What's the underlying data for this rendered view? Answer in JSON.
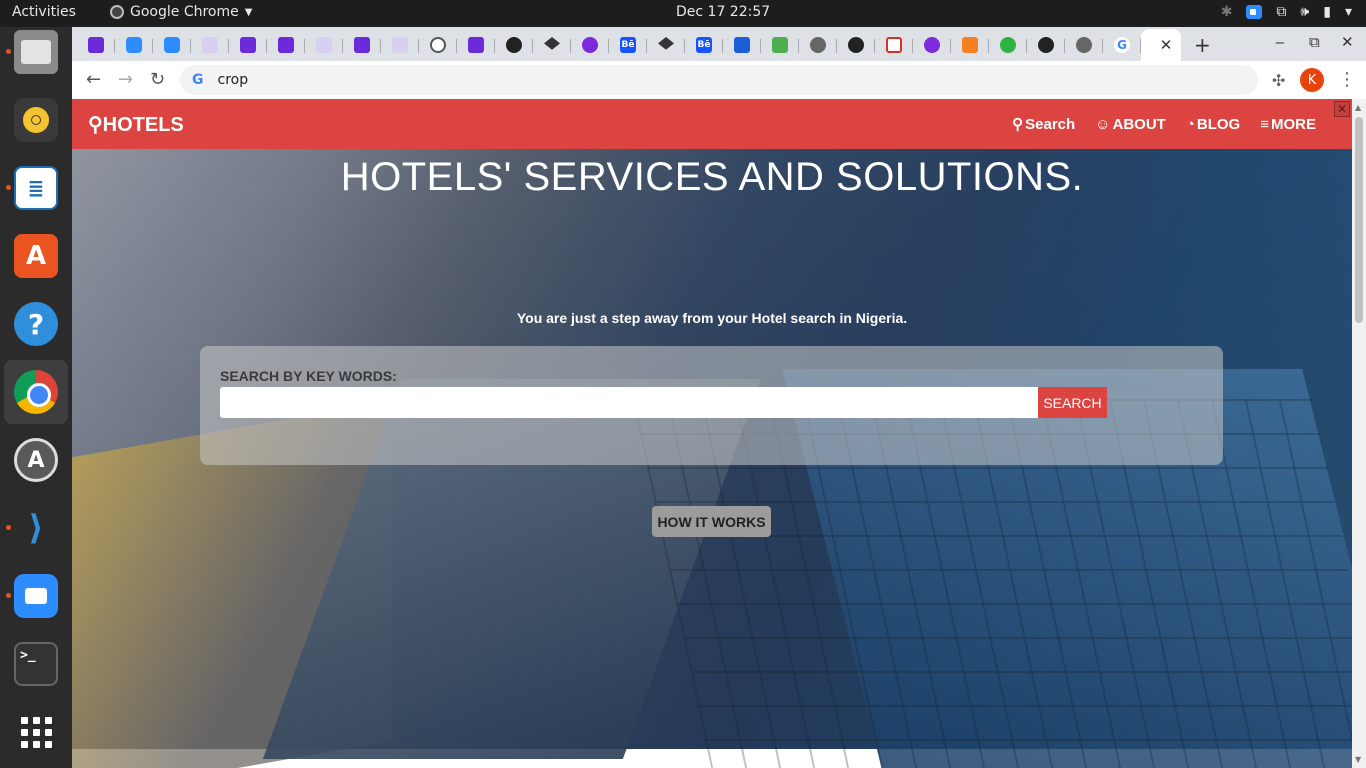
{
  "system": {
    "activities": "Activities",
    "app_name": "Google Chrome",
    "clock": "Dec 17  22:57"
  },
  "dock": {
    "items": [
      {
        "name": "files",
        "icon": "folder-icon"
      },
      {
        "name": "rhythmbox",
        "icon": "music-player-icon"
      },
      {
        "name": "libreoffice-writer",
        "icon": "writer-icon"
      },
      {
        "name": "ubuntu-software",
        "icon": "store-icon"
      },
      {
        "name": "help",
        "icon": "help-icon"
      },
      {
        "name": "google-chrome",
        "icon": "chrome-icon"
      },
      {
        "name": "software-updater",
        "icon": "update-icon"
      },
      {
        "name": "vscode",
        "icon": "vscode-icon"
      },
      {
        "name": "zoom",
        "icon": "zoom-icon"
      },
      {
        "name": "terminal",
        "icon": "terminal-icon"
      },
      {
        "name": "show-applications",
        "icon": "grid-icon"
      }
    ]
  },
  "browser": {
    "address": "crop",
    "profile_initial": "K",
    "active_tab_close": "✕",
    "new_tab": "+"
  },
  "site": {
    "brand": "HOTELS",
    "nav": {
      "search": "Search",
      "about": "ABOUT",
      "blog": "BLOG",
      "more": "MORE"
    },
    "hero_title": "HOTELS' SERVICES AND SOLUTIONS.",
    "hero_subtitle": "You are just a step away from your Hotel search in Nigeria.",
    "search_label": "SEARCH BY KEY WORDS:",
    "search_value": "",
    "search_button": "SEARCH",
    "how_it_works": "HOW IT WORKS"
  },
  "colors": {
    "brand_red": "#db4440",
    "topbar": "#1d1d1d",
    "dock": "#2b2b2b"
  }
}
